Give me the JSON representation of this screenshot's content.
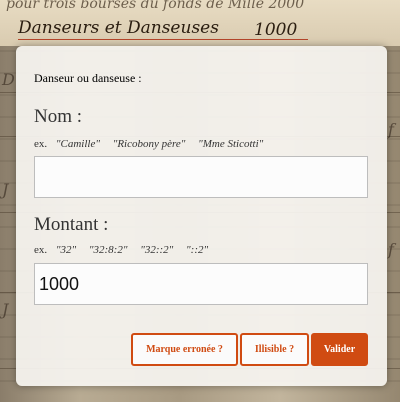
{
  "background": {
    "header_script": "Danseurs et Danseuses",
    "header_amount": "1000",
    "top_script": "pour trois bourses du fonds de Mille 2000"
  },
  "dialog": {
    "title": "Danseur ou danseuse :",
    "nom": {
      "label": "Nom :",
      "examples_prefix": "ex.",
      "examples": [
        "\"Camille\"",
        "\"Ricobony père\"",
        "\"Mme Sticotti\""
      ],
      "value": "",
      "placeholder": ""
    },
    "montant": {
      "label": "Montant :",
      "examples_prefix": "ex.",
      "examples": [
        "\"32\"",
        "\"32:8:2\"",
        "\"32::2\"",
        "\"::2\""
      ],
      "value": "1000"
    },
    "buttons": {
      "wrong_mark": "Marque erronée ?",
      "illegible": "Illisible ?",
      "validate": "Valider"
    }
  },
  "colors": {
    "accent": "#d04b12",
    "dialog_bg": "#f6f4f0"
  }
}
